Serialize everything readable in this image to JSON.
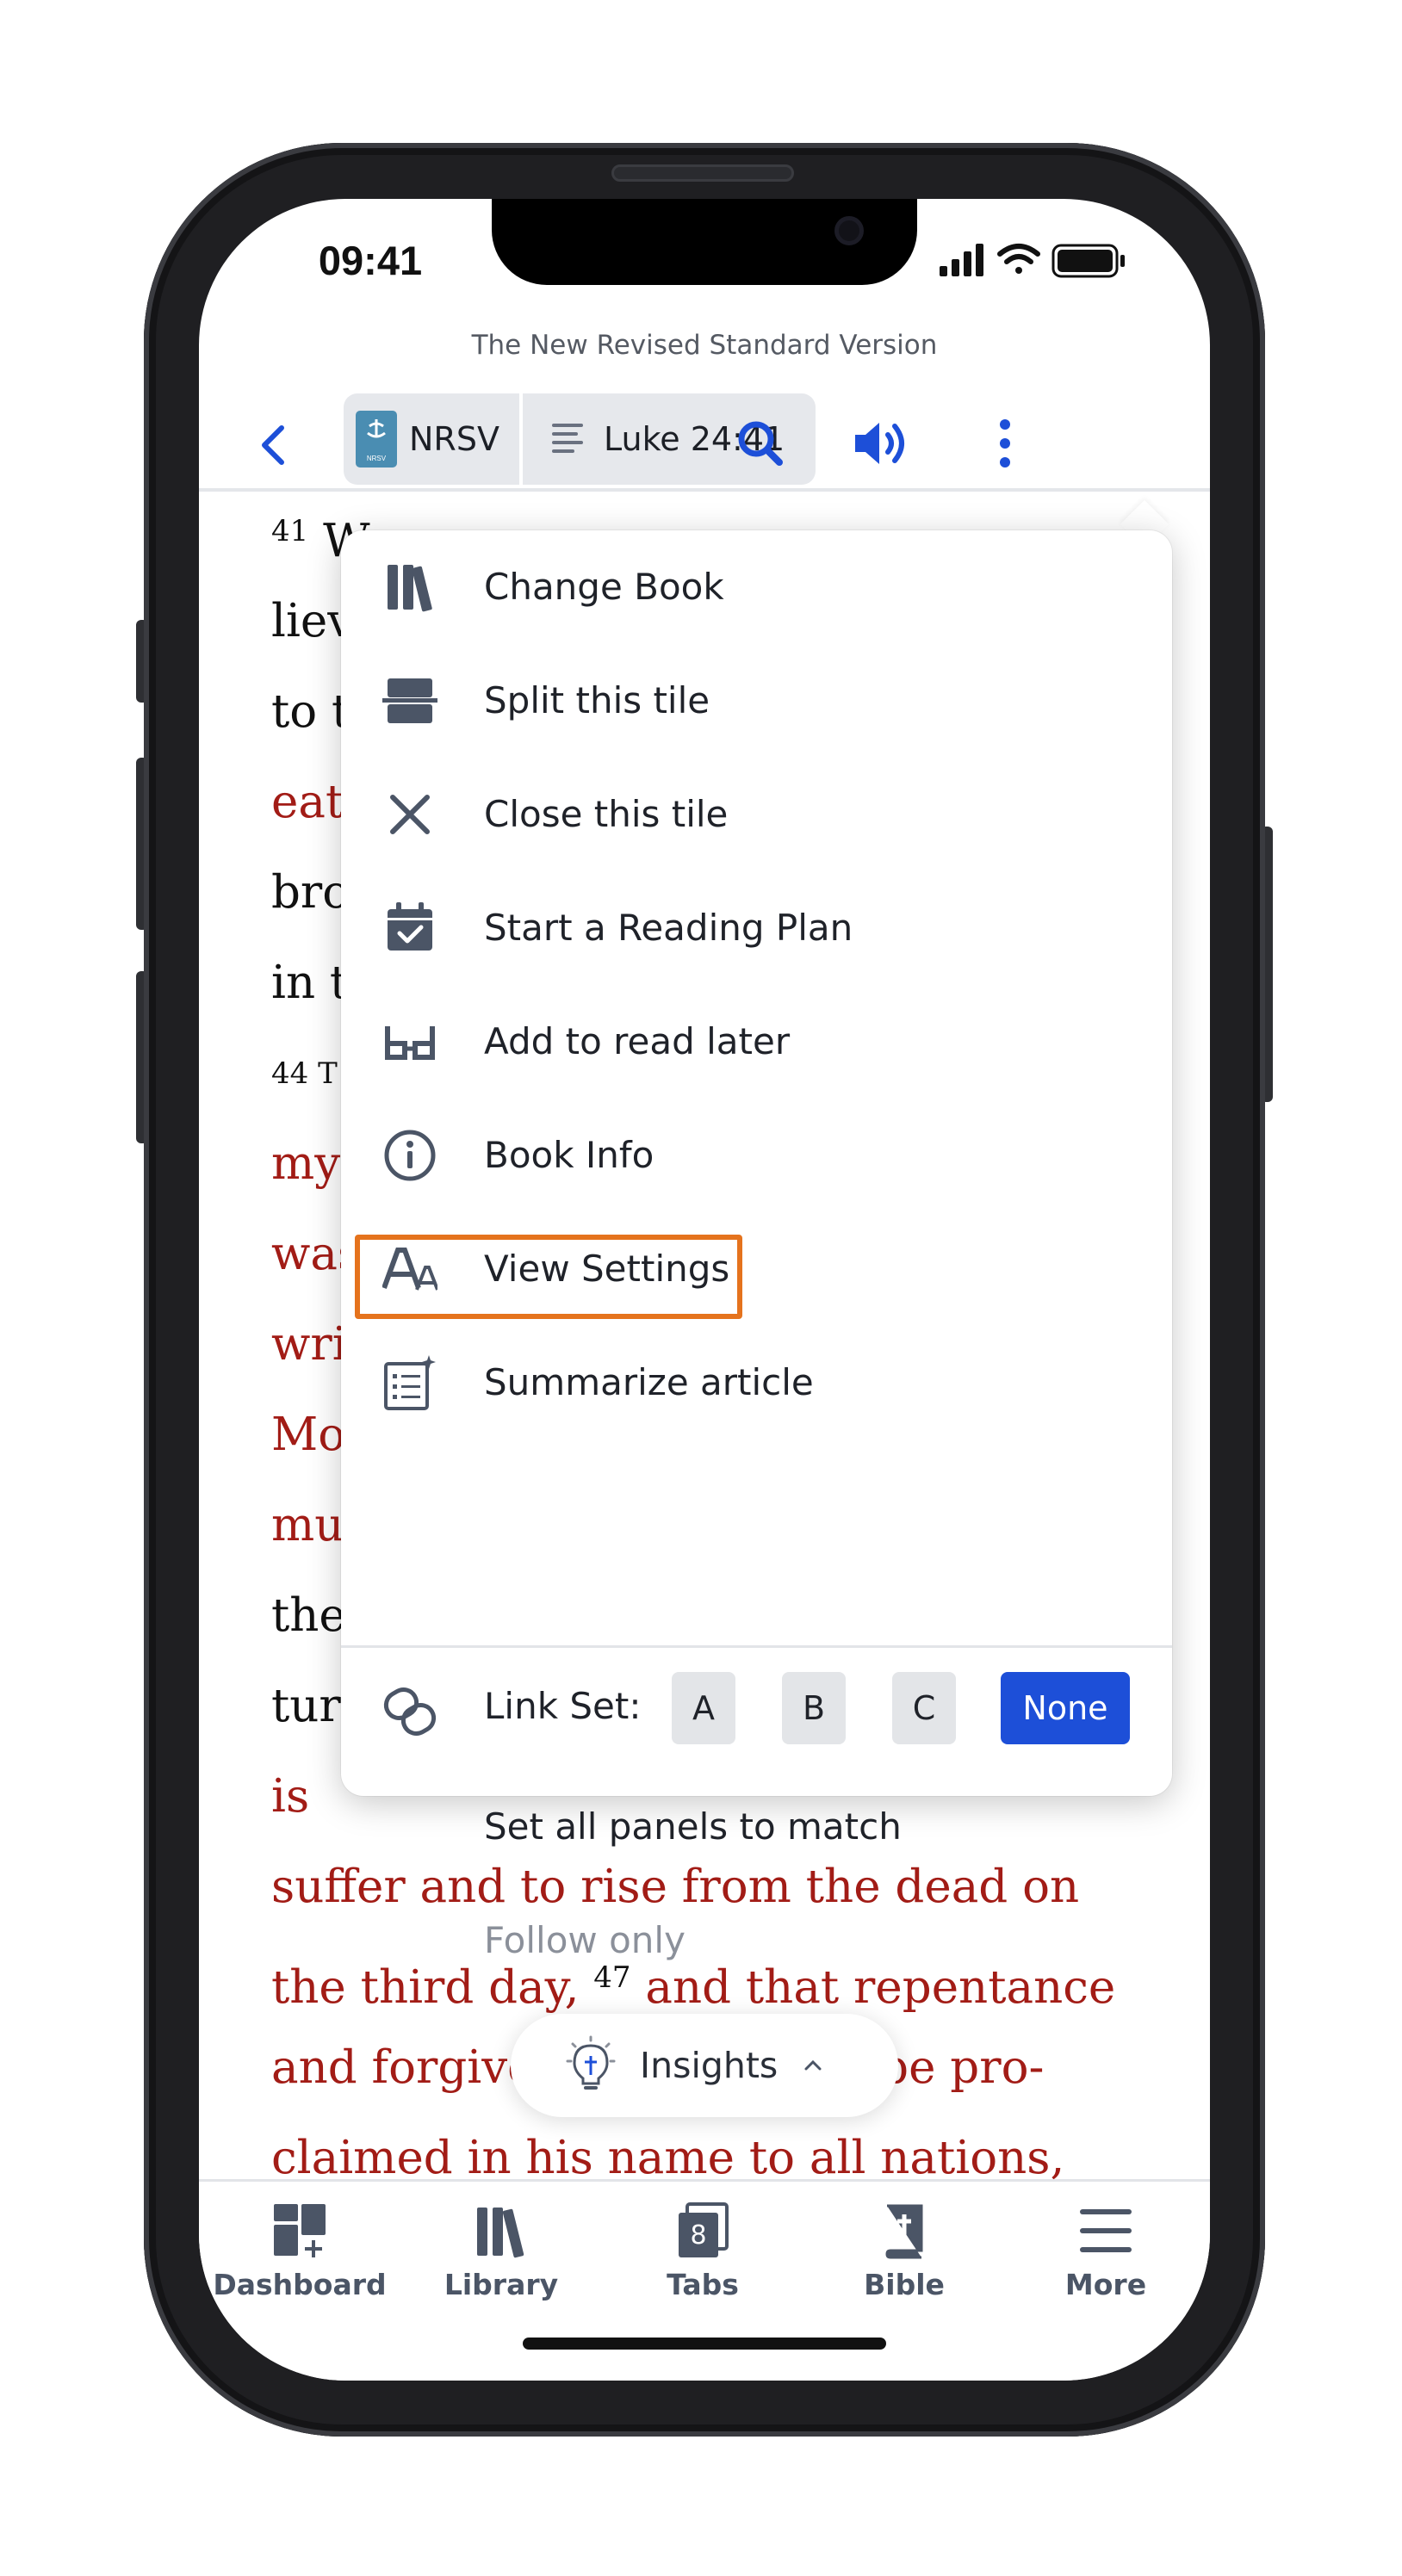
{
  "status_bar": {
    "time": "09:41"
  },
  "header": {
    "version_title": "The New Revised Standard Version",
    "version_button": "NRSV",
    "version_badge_text": "NRSV",
    "reference_button": "Luke 24:41"
  },
  "reader": {
    "lines": [
      {
        "parts": [
          {
            "t": "41",
            "c": "vnum"
          },
          {
            "t": " W",
            "c": "black"
          }
        ]
      },
      {
        "parts": [
          {
            "t": "liev",
            "c": "black"
          }
        ]
      },
      {
        "parts": [
          {
            "t": "to t",
            "c": "black"
          }
        ]
      },
      {
        "parts": [
          {
            "t": "eat",
            "c": "red"
          }
        ]
      },
      {
        "parts": [
          {
            "t": "bro",
            "c": "black"
          }
        ]
      },
      {
        "parts": [
          {
            "t": "in t",
            "c": "black"
          }
        ]
      },
      {
        "parts": [
          {
            "t": "44 T",
            "c": "vnum"
          }
        ]
      },
      {
        "parts": [
          {
            "t": "my",
            "c": "red"
          }
        ]
      },
      {
        "parts": [
          {
            "t": "was",
            "c": "red"
          }
        ]
      },
      {
        "parts": [
          {
            "t": "wri",
            "c": "red"
          }
        ]
      },
      {
        "parts": [
          {
            "t": "Mo",
            "c": "red"
          }
        ]
      },
      {
        "parts": [
          {
            "t": "mu",
            "c": "red"
          }
        ]
      },
      {
        "parts": [
          {
            "t": "the",
            "c": "black"
          }
        ]
      },
      {
        "parts": [
          {
            "t": "tur",
            "c": "black"
          }
        ]
      },
      {
        "parts": [
          {
            "t": "is ",
            "c": "red"
          }
        ]
      },
      {
        "parts": [
          {
            "t": "suffer and to rise from the dead on",
            "c": "red"
          }
        ]
      },
      {
        "parts": [
          {
            "t": "the third day, ",
            "c": "red"
          },
          {
            "t": "47",
            "c": "vnum"
          },
          {
            "t": " and that repentance",
            "c": "red"
          }
        ]
      },
      {
        "parts": [
          {
            "t": "and forgive",
            "c": "red"
          },
          {
            "t": "                is to be pro-",
            "c": "red"
          }
        ]
      },
      {
        "parts": [
          {
            "t": "claimed in his name to all nations,",
            "c": "red"
          }
        ]
      }
    ]
  },
  "menu": {
    "items": [
      {
        "label": "Change Book",
        "icon": "books-icon"
      },
      {
        "label": "Split this tile",
        "icon": "split-icon"
      },
      {
        "label": "Close this tile",
        "icon": "close-icon"
      },
      {
        "label": "Start a Reading Plan",
        "icon": "calendar-check-icon"
      },
      {
        "label": "Add to read later",
        "icon": "glasses-icon"
      },
      {
        "label": "Book Info",
        "icon": "info-icon"
      },
      {
        "label": "View Settings",
        "icon": "text-size-icon"
      },
      {
        "label": "Summarize article",
        "icon": "summarize-icon"
      }
    ],
    "link_set": {
      "label": "Link Set:",
      "options": [
        "A",
        "B",
        "C",
        "None"
      ],
      "selected": "None"
    },
    "set_all_panels": "Set all panels to match",
    "follow_only": "Follow only",
    "highlight_color": "#e5731d"
  },
  "insights": {
    "label": "Insights"
  },
  "tabbar": {
    "tabs": [
      {
        "label": "Dashboard",
        "icon": "dashboard-icon"
      },
      {
        "label": "Library",
        "icon": "library-icon"
      },
      {
        "label": "Tabs",
        "icon": "tabs-icon",
        "badge": "8"
      },
      {
        "label": "Bible",
        "icon": "bible-icon"
      },
      {
        "label": "More",
        "icon": "more-icon"
      }
    ]
  },
  "colors": {
    "accent": "#1d4fd8",
    "words_of_christ": "#a21c16",
    "icon_gray": "#4b5566"
  }
}
